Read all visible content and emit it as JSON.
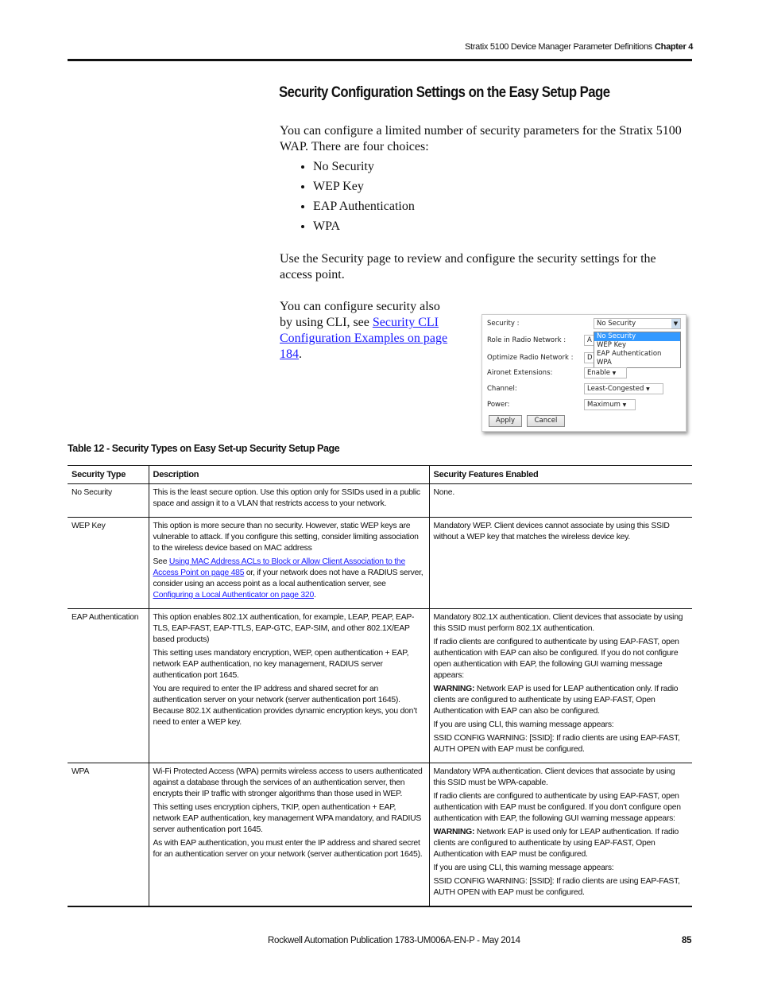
{
  "header": {
    "running_title": "Stratix 5100 Device Manager Parameter Definitions",
    "chapter": "Chapter 4"
  },
  "section_title": "Security Configuration Settings on the Easy Setup Page",
  "intro": "You can configure a limited number of security parameters for the Stratix 5100 WAP. There are four choices:",
  "choices": [
    "No Security",
    "WEP Key",
    "EAP Authentication",
    "WPA"
  ],
  "use_text": "Use the Security page to review and configure the security settings for the access point.",
  "cli_text": {
    "before": "You can configure security also by using CLI, see ",
    "link": "Security CLI Configuration Examples on page 184",
    "after": "."
  },
  "screenshot": {
    "security_label": "Security :",
    "security_value": "No Security",
    "options": [
      "No Security",
      "WEP Key",
      "EAP Authentication",
      "WPA"
    ],
    "role_label": "Role in Radio Network :",
    "role_value": "A",
    "optimize_label": "Optimize Radio Network :",
    "optimize_value": "D",
    "aironet_label": "Aironet Extensions:",
    "aironet_value": "Enable",
    "channel_label": "Channel:",
    "channel_value": "Least-Congested",
    "power_label": "Power:",
    "power_value": "Maximum",
    "apply": "Apply",
    "cancel": "Cancel",
    "highlight": "#3399ff"
  },
  "table": {
    "caption": "Table 12 - Security Types on Easy Set-up Security Setup Page",
    "headers": [
      "Security Type",
      "Description",
      "Security Features Enabled"
    ],
    "rows": [
      {
        "type": "No Security",
        "description": [
          [
            {
              "t": "This is the least secure option. Use this option only for SSIDs used in a public space and assign it to a VLAN that restricts access to your network."
            }
          ]
        ],
        "features": [
          [
            {
              "t": "None."
            }
          ]
        ]
      },
      {
        "type": "WEP Key",
        "description": [
          [
            {
              "t": "This option is more secure than no security. However, static WEP keys are vulnerable to attack. If you configure this setting, consider limiting association to the wireless device based on MAC address"
            }
          ],
          [
            {
              "t": "See "
            },
            {
              "link": "Using MAC Address ACLs to Block or Allow Client Association to the Access Point on page 485"
            },
            {
              "t": " or, if your network does not have a RADIUS server, consider using an access point as a local authentication server, see "
            },
            {
              "link": "Configuring a Local Authenticator on page 320"
            },
            {
              "t": "."
            }
          ]
        ],
        "features": [
          [
            {
              "t": "Mandatory WEP. Client devices cannot associate by using this SSID without a WEP key that matches the wireless device key."
            }
          ]
        ]
      },
      {
        "type": "EAP Authentication",
        "description": [
          [
            {
              "t": "This option enables 802.1X authentication, for example, LEAP, PEAP, EAP-TLS, EAP-FAST, EAP-TTLS, EAP-GTC, EAP-SIM, and other 802.1X/EAP based products)"
            }
          ],
          [
            {
              "t": "This setting uses mandatory encryption, WEP, open authentication + EAP, network EAP authentication, no key management, RADIUS server authentication port 1645."
            }
          ],
          [
            {
              "t": "You are required to enter the IP address and shared secret for an authentication server on your network (server authentication port 1645). Because 802.1X authentication provides dynamic encryption keys, you don’t need to enter a WEP key."
            }
          ]
        ],
        "features": [
          [
            {
              "t": "Mandatory 802.1X authentication. Client devices that associate by using this SSID must perform 802.1X authentication."
            }
          ],
          [
            {
              "t": "If radio clients are configured to authenticate by using EAP-FAST, open authentication with EAP can also be configured. If you do not configure open authentication with EAP, the following GUI warning message appears:"
            }
          ],
          [
            {
              "b": "WARNING:"
            },
            {
              "t": " Network EAP is used for LEAP authentication only. If radio clients are configured to authenticate by using EAP-FAST, Open Authentication with EAP can also be configured."
            }
          ],
          [
            {
              "t": "If you are using CLI, this warning message appears:"
            }
          ],
          [
            {
              "t": "SSID CONFIG WARNING: [SSID]: If radio clients are using EAP-FAST, AUTH OPEN with EAP must be configured."
            }
          ]
        ]
      },
      {
        "type": "WPA",
        "description": [
          [
            {
              "t": "Wi-Fi Protected Access (WPA) permits wireless access to users authenticated against a database through the services of an authentication server, then encrypts their IP traffic with stronger algorithms than those used in WEP."
            }
          ],
          [
            {
              "t": "This setting uses encryption ciphers, TKIP, open authentication + EAP, network EAP authentication, key management WPA mandatory, and RADIUS server authentication port 1645."
            }
          ],
          [
            {
              "t": "As with EAP authentication, you must enter the IP address and shared secret for an authentication server on your network (server authentication port 1645)."
            }
          ]
        ],
        "features": [
          [
            {
              "t": "Mandatory WPA authentication. Client devices that associate by using this SSID must be WPA-capable."
            }
          ],
          [
            {
              "t": "If radio clients are configured to authenticate by using EAP-FAST, open authentication with EAP must be configured. If you don’t configure open authentication with EAP, the following GUI warning message appears:"
            }
          ],
          [
            {
              "b": "WARNING:"
            },
            {
              "t": " Network EAP is used only for LEAP authentication. If radio clients are configured to authenticate by using EAP-FAST, Open Authentication with EAP must be configured."
            }
          ],
          [
            {
              "t": "If you are using CLI, this warning message appears:"
            }
          ],
          [
            {
              "t": "SSID CONFIG WARNING: [SSID]: If radio clients are using EAP-FAST, AUTH OPEN with EAP must be configured."
            }
          ]
        ]
      }
    ]
  },
  "footer": {
    "publication": "Rockwell Automation Publication 1783-UM006A-EN-P - May 2014",
    "page_number": "85"
  }
}
